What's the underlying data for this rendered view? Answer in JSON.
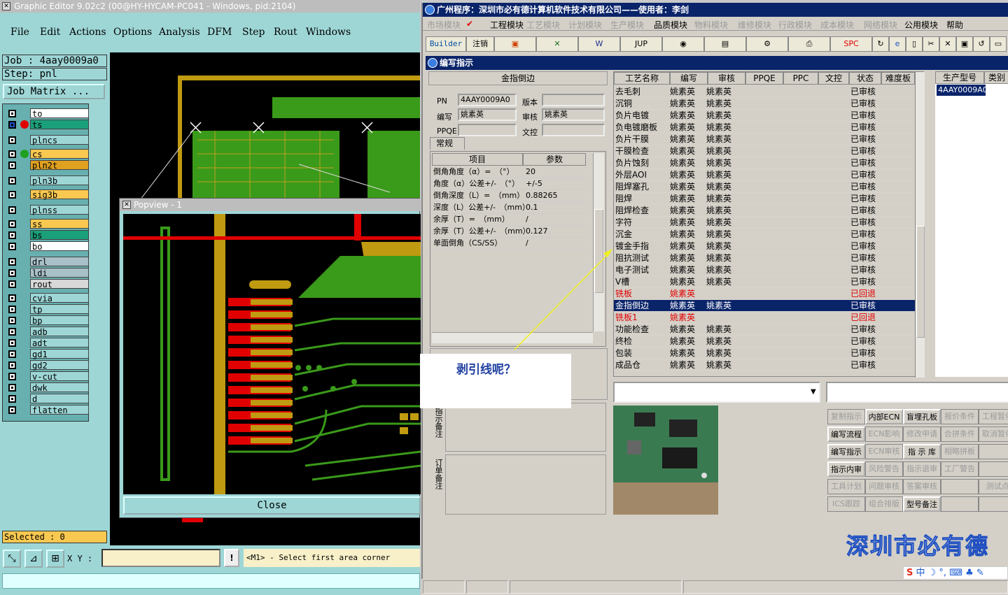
{
  "graphic_editor": {
    "window_title": "Graphic Editor 9.02c2 (00@HY-HYCAM-PC041 - Windows, pid:2104)",
    "menu": [
      "File",
      "Edit",
      "Actions",
      "Options",
      "Analysis",
      "DFM",
      "Step",
      "Rout",
      "Windows"
    ],
    "job_label": "Job : 4aay0009a0",
    "step_label": "Step: pnl",
    "job_matrix_button": "Job Matrix ...",
    "layers": [
      {
        "name": "to",
        "color": "#ffffff",
        "dot": ""
      },
      {
        "name": "ts",
        "color": "#1aa07a",
        "dot": "#e00000",
        "checked": true
      },
      {
        "name": "plncs",
        "color": "#9ed6d6",
        "dot": ""
      },
      {
        "name": "cs",
        "color": "#f8c850",
        "dot": "#20a020"
      },
      {
        "name": "pln2t",
        "color": "#e0a020",
        "dot": ""
      },
      {
        "name": "pln3b",
        "color": "#9ed6d6",
        "dot": ""
      },
      {
        "name": "sig3b",
        "color": "#f8c850",
        "dot": ""
      },
      {
        "name": "plnss",
        "color": "#9ed6d6",
        "dot": ""
      },
      {
        "name": "ss",
        "color": "#f8c850",
        "dot": ""
      },
      {
        "name": "bs",
        "color": "#1aa07a",
        "dot": ""
      },
      {
        "name": "bo",
        "color": "#ffffff",
        "dot": ""
      },
      {
        "name": "drl",
        "color": "#a8c0c8",
        "dot": ""
      },
      {
        "name": "ldi",
        "color": "#a8c0c8",
        "dot": ""
      },
      {
        "name": "rout",
        "color": "#d8d8d8",
        "dot": ""
      },
      {
        "name": "cvia",
        "color": "#9ed6d6",
        "dot": ""
      },
      {
        "name": "tp",
        "color": "#9ed6d6",
        "dot": ""
      },
      {
        "name": "bp",
        "color": "#9ed6d6",
        "dot": ""
      },
      {
        "name": "adb",
        "color": "#9ed6d6",
        "dot": ""
      },
      {
        "name": "adt",
        "color": "#9ed6d6",
        "dot": ""
      },
      {
        "name": "gd1",
        "color": "#9ed6d6",
        "dot": ""
      },
      {
        "name": "gd2",
        "color": "#9ed6d6",
        "dot": ""
      },
      {
        "name": "v-cut",
        "color": "#9ed6d6",
        "dot": ""
      },
      {
        "name": "dwk",
        "color": "#9ed6d6",
        "dot": ""
      },
      {
        "name": "d",
        "color": "#9ed6d6",
        "dot": ""
      },
      {
        "name": "flatten",
        "color": "#9ed6d6",
        "dot": ""
      }
    ],
    "selected_label": "Selected : 0",
    "xy_label": "X Y :",
    "xy_value": "",
    "status_message": "<M1> - Select first area corner",
    "popview": {
      "title": "Popview - 1",
      "close_label": "Close"
    }
  },
  "erp": {
    "window_title": "广州程序：深圳市必有德计算机软件技术有限公司——使用者：李剑",
    "menu": [
      {
        "label": "市场模块",
        "active": false
      },
      {
        "label": "工程模块",
        "active": true
      },
      {
        "label": "工艺模块",
        "active": false
      },
      {
        "label": "计划模块",
        "active": false
      },
      {
        "label": "生产模块",
        "active": false
      },
      {
        "label": "品质模块",
        "active": true
      },
      {
        "label": "物料模块",
        "active": false
      },
      {
        "label": "维修模块",
        "active": false
      },
      {
        "label": "行政模块",
        "active": false
      },
      {
        "label": "成本模块",
        "active": false
      },
      {
        "label": "网络模块",
        "active": false
      },
      {
        "label": "公用模块",
        "active": true
      },
      {
        "label": "帮助",
        "active": true
      }
    ],
    "toolbar": {
      "builder": "Builder",
      "logout": "注销",
      "jup": "JUP",
      "spc": "SPC"
    },
    "subwindow_title": "编写指示",
    "form": {
      "process_name": "金指倒边",
      "pn_label": "PN",
      "pn_value": "4AAY0009A0",
      "version_label": "版本",
      "version_value": "",
      "author_label": "编写",
      "author_value": "姚素英",
      "review_label": "审核",
      "review_value": "姚素英",
      "ppqe_label": "PPQE",
      "ppqe_value": "",
      "doc_label": "文控",
      "doc_value": "",
      "tab_label": "常规",
      "param_header_item": "项目",
      "param_header_value": "参数",
      "params": [
        {
          "item": "倒角角度（α）=　（°）",
          "value": "20"
        },
        {
          "item": "角度（α）公差+/-　（°）",
          "value": "+/-5"
        },
        {
          "item": "倒角深度（L）=　（mm）",
          "value": "0.88265"
        },
        {
          "item": "深度（L）公差+/-　（mm）",
          "value": "0.1"
        },
        {
          "item": "余厚（T）=　（mm）",
          "value": "/"
        },
        {
          "item": "余厚（T）公差+/-　（mm）",
          "value": "0.127"
        },
        {
          "item": "单面倒角（CS/SS）",
          "value": "/"
        }
      ],
      "note_label_1": "指示备注",
      "note_label_2": "订单备注"
    },
    "grid": {
      "headers": [
        "工艺名称",
        "编写",
        "审核",
        "PPQE",
        "PPC",
        "文控",
        "状态",
        "难度板"
      ],
      "rows": [
        {
          "name": "去毛刺",
          "author": "姚素英",
          "review": "姚素英",
          "status": "已审核",
          "style": ""
        },
        {
          "name": "沉铜",
          "author": "姚素英",
          "review": "姚素英",
          "status": "已审核",
          "style": ""
        },
        {
          "name": "负片电镀",
          "author": "姚素英",
          "review": "姚素英",
          "status": "已审核",
          "style": ""
        },
        {
          "name": "负电镀磨板",
          "author": "姚素英",
          "review": "姚素英",
          "status": "已审核",
          "style": ""
        },
        {
          "name": "负片干膜",
          "author": "姚素英",
          "review": "姚素英",
          "status": "已审核",
          "style": ""
        },
        {
          "name": "干膜检查",
          "author": "姚素英",
          "review": "姚素英",
          "status": "已审核",
          "style": ""
        },
        {
          "name": "负片蚀刻",
          "author": "姚素英",
          "review": "姚素英",
          "status": "已审核",
          "style": ""
        },
        {
          "name": "外层AOI",
          "author": "姚素英",
          "review": "姚素英",
          "status": "已审核",
          "style": ""
        },
        {
          "name": "阻焊塞孔",
          "author": "姚素英",
          "review": "姚素英",
          "status": "已审核",
          "style": ""
        },
        {
          "name": "阻焊",
          "author": "姚素英",
          "review": "姚素英",
          "status": "已审核",
          "style": ""
        },
        {
          "name": "阻焊检查",
          "author": "姚素英",
          "review": "姚素英",
          "status": "已审核",
          "style": ""
        },
        {
          "name": "字符",
          "author": "姚素英",
          "review": "姚素英",
          "status": "已审核",
          "style": ""
        },
        {
          "name": "沉金",
          "author": "姚素英",
          "review": "姚素英",
          "status": "已审核",
          "style": ""
        },
        {
          "name": "镀金手指",
          "author": "姚素英",
          "review": "姚素英",
          "status": "已审核",
          "style": ""
        },
        {
          "name": "阻抗测试",
          "author": "姚素英",
          "review": "姚素英",
          "status": "已审核",
          "style": ""
        },
        {
          "name": "电子测试",
          "author": "姚素英",
          "review": "姚素英",
          "status": "已审核",
          "style": ""
        },
        {
          "name": "V槽",
          "author": "姚素英",
          "review": "姚素英",
          "status": "已审核",
          "style": ""
        },
        {
          "name": "铣板",
          "author": "姚素英",
          "review": "",
          "status": "已回退",
          "style": "red"
        },
        {
          "name": "金指倒边",
          "author": "姚素英",
          "review": "姚素英",
          "status": "已审核",
          "style": "sel"
        },
        {
          "name": "铣板1",
          "author": "姚素英",
          "review": "",
          "status": "已回退",
          "style": "red"
        },
        {
          "name": "功能检查",
          "author": "姚素英",
          "review": "姚素英",
          "status": "已审核",
          "style": ""
        },
        {
          "name": "终检",
          "author": "姚素英",
          "review": "姚素英",
          "status": "已审核",
          "style": ""
        },
        {
          "name": "包装",
          "author": "姚素英",
          "review": "姚素英",
          "status": "已审核",
          "style": ""
        },
        {
          "name": "成品仓",
          "author": "姚素英",
          "review": "姚素英",
          "status": "已审核",
          "style": ""
        }
      ]
    },
    "side": {
      "header_model": "生产型号",
      "header_type": "类别",
      "selected_model": "4AAY0009A0"
    },
    "buttons": [
      [
        {
          "label": "复制指示",
          "on": false
        },
        {
          "label": "内部ECN",
          "on": true
        },
        {
          "label": "盲埋孔板",
          "on": true
        },
        {
          "label": "报价条件",
          "on": false
        },
        {
          "label": "工程暂停",
          "on": false
        }
      ],
      [
        {
          "label": "编写流程",
          "on": true
        },
        {
          "label": "ECN影响",
          "on": false
        },
        {
          "label": "修改申请",
          "on": false
        },
        {
          "label": "合拼条件",
          "on": false
        },
        {
          "label": "取消暂停",
          "on": false
        }
      ],
      [
        {
          "label": "编写指示",
          "on": true
        },
        {
          "label": "ECN审核",
          "on": false
        },
        {
          "label": "指 示 库",
          "on": true
        },
        {
          "label": "相略拼板",
          "on": false
        },
        {
          "label": "",
          "on": false
        }
      ],
      [
        {
          "label": "指示内审",
          "on": true
        },
        {
          "label": "风险警告",
          "on": false
        },
        {
          "label": "指示退审",
          "on": false
        },
        {
          "label": "工厂警告",
          "on": false
        },
        {
          "label": "",
          "on": false
        }
      ],
      [
        {
          "label": "工具计划",
          "on": false
        },
        {
          "label": "问题审核",
          "on": false
        },
        {
          "label": "答案审核",
          "on": false
        },
        {
          "label": "",
          "on": false
        },
        {
          "label": "测试点",
          "on": false
        }
      ],
      [
        {
          "label": "ICS跟踪",
          "on": false
        },
        {
          "label": "组合排版",
          "on": false
        },
        {
          "label": "型号备注",
          "on": true
        },
        {
          "label": "",
          "on": false
        },
        {
          "label": "",
          "on": false
        }
      ]
    ],
    "company_banner": "深圳市必有德",
    "ime_bar": "中 ☽ °, ⌨ ♣ ✎"
  },
  "callout_text": "剥引线呢？"
}
